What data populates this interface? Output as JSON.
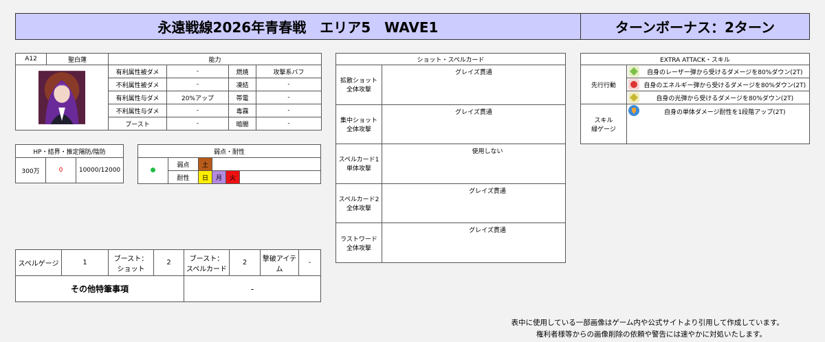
{
  "header": {
    "title": "永遠戦線2026年青春戦　エリア5　WAVE1",
    "bonus": "ターンボーナス：2ターン"
  },
  "character": {
    "id": "A12",
    "name": "聖白蓮",
    "ability_header": "能力",
    "abilities": [
      {
        "label": "有利属性被ダメ",
        "value": "-",
        "status": "燃焼",
        "status_value": "攻撃系バフ"
      },
      {
        "label": "不利属性被ダメ",
        "value": "-",
        "status": "凍結",
        "status_value": "-"
      },
      {
        "label": "有利属性与ダメ",
        "value": "20%アップ",
        "status": "帯電",
        "status_value": "-"
      },
      {
        "label": "不利属性与ダメ",
        "value": "-",
        "status": "毒霧",
        "status_value": "-"
      },
      {
        "label": "ブースト",
        "value": "-",
        "status": "暗闇",
        "status_value": "-"
      }
    ]
  },
  "hp": {
    "header": "HP・結界・推定陽防/陰防",
    "hp": "300万",
    "barrier": "0",
    "defense": "10000/12000"
  },
  "weakness": {
    "header": "弱点・耐性",
    "weak_label": "弱点",
    "resist_label": "耐性",
    "weak": [
      {
        "name": "土",
        "color": "#b85a1a"
      }
    ],
    "resist": [
      {
        "name": "日",
        "color": "#ffee00"
      },
      {
        "name": "月",
        "color": "#b48ae0"
      },
      {
        "name": "火",
        "color": "#ee1111"
      }
    ],
    "dot_color": "#22bb44"
  },
  "shots": {
    "header": "ショット・スペルカード",
    "rows": [
      {
        "name1": "拡散ショット",
        "name2": "全体攻撃",
        "desc": "グレイズ貫通"
      },
      {
        "name1": "集中ショット",
        "name2": "全体攻撃",
        "desc": "グレイズ貫通"
      },
      {
        "name1": "スペルカード1",
        "name2": "単体攻撃",
        "desc": "使用しない"
      },
      {
        "name1": "スペルカード2",
        "name2": "全体攻撃",
        "desc": "グレイズ貫通"
      },
      {
        "name1": "ラストワード",
        "name2": "全体攻撃",
        "desc": "グレイズ貫通"
      }
    ]
  },
  "extra": {
    "header": "EXTRA ATTACK・スキル",
    "first_label": "先行行動",
    "skill_label1": "スキル",
    "skill_label2": "緑ゲージ",
    "first_rows": [
      {
        "icon": "laser-icon",
        "text": "自身のレーザー弾から受けるダメージを80%ダウン(2T)"
      },
      {
        "icon": "energy-icon",
        "text": "自身のエネルギー弾から受けるダメージを80%ダウン(2T)"
      },
      {
        "icon": "light-icon",
        "text": "自身の光弾から受けるダメージを80%ダウン(2T)"
      }
    ],
    "skill_rows": [
      {
        "icon": "shield-icon",
        "text": "自身の単体ダメージ耐性を1段階アップ(2T)"
      }
    ]
  },
  "bottom": {
    "spell_gauge_label": "スペルゲージ",
    "spell_gauge": "1",
    "boost_shot_label1": "ブースト：",
    "boost_shot_label2": "ショット",
    "boost_shot": "2",
    "boost_spell_label1": "ブースト：",
    "boost_spell_label2": "スペルカード",
    "boost_spell": "2",
    "item_label": "撃破アイテム",
    "item": "-",
    "notes_label": "その他特筆事項",
    "notes": "-"
  },
  "footer": {
    "line1": "表中に使用している一部画像はゲーム内や公式サイトより引用して作成しています。",
    "line2": "権利者様等からの画像削除の依頼や警告には速やかに対処いたします。"
  }
}
